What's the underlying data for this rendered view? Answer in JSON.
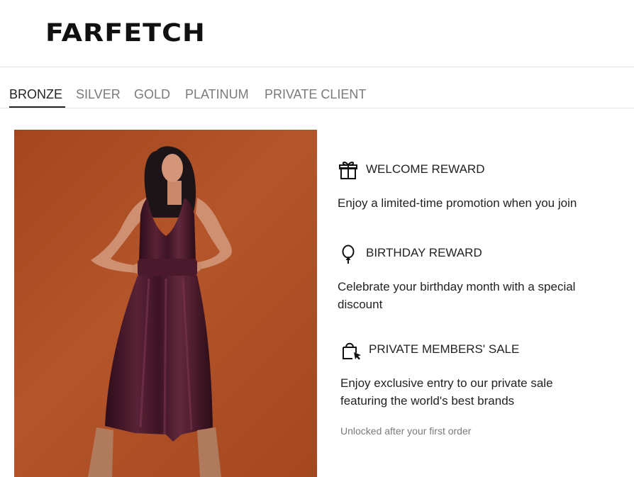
{
  "brand": {
    "logo_text": "FARFETCH"
  },
  "tabs": [
    {
      "label": "BRONZE",
      "active": true
    },
    {
      "label": "SILVER",
      "active": false
    },
    {
      "label": "GOLD",
      "active": false
    },
    {
      "label": "PLATINUM",
      "active": false
    },
    {
      "label": "PRIVATE CLIENT",
      "active": false
    }
  ],
  "benefits": [
    {
      "icon": "gift-icon",
      "title": "WELCOME REWARD",
      "description": "Enjoy a limited-time promotion when you join"
    },
    {
      "icon": "balloon-icon",
      "title": "BIRTHDAY REWARD",
      "description": "Celebrate your birthday month with a special discount"
    },
    {
      "icon": "shopping-bag-cursor-icon",
      "title": "PRIVATE MEMBERS' SALE",
      "description": "Enjoy exclusive entry to our private sale featuring the world's best brands"
    }
  ],
  "unlock_note": "Unlocked after your first order",
  "colors": {
    "text": "#222222",
    "muted": "#7a7a7a",
    "hero_background": "#a84b22",
    "dress": "#3e1526"
  }
}
